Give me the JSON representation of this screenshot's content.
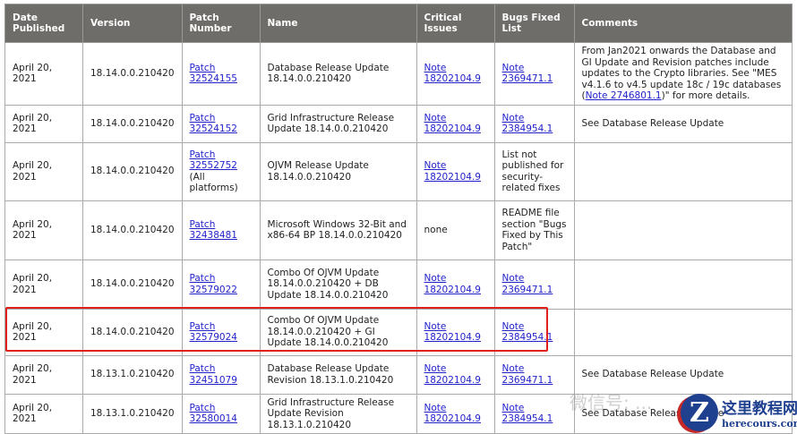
{
  "headers": [
    "Date Published",
    "Version",
    "Patch Number",
    "Name",
    "Critical Issues",
    "Bugs Fixed List",
    "Comments"
  ],
  "rows": [
    {
      "date": "April 20, 2021",
      "version": "18.14.0.0.210420",
      "patch": "Patch 32524155",
      "name": "Database Release Update 18.14.0.0.210420",
      "critical": "Note 18202104.9",
      "bugs": "Note 2369471.1",
      "comment_pre": "From Jan2021 onwards the Database and GI Update and Revision patches include updates to the Crypto libraries. See \"MES v4.1.6 to v4.5 update 18c / 19c databases (",
      "comment_link": "Note 2746801.1",
      "comment_post": ")\" for more details."
    },
    {
      "date": "April 20, 2021",
      "version": "18.14.0.0.210420",
      "patch": "Patch 32524152",
      "name": "Grid Infrastructure Release Update 18.14.0.0.210420",
      "critical": "Note 18202104.9",
      "bugs": "Note 2384954.1",
      "comment": "See Database Release Update"
    },
    {
      "date": "April 20, 2021",
      "version": "18.14.0.0.210420",
      "patch": "Patch 32552752",
      "patch_suffix": " (All platforms)",
      "name": "OJVM Release Update 18.14.0.0.210420",
      "critical": "Note 18202104.9",
      "bugs_text": "List not published for security-related fixes",
      "comment": ""
    },
    {
      "date": "April 20, 2021",
      "version": "18.14.0.0.210420",
      "patch": "Patch 32438481",
      "name": "Microsoft Windows 32-Bit and x86-64 BP 18.14.0.0.210420",
      "critical_text": "none",
      "bugs_text": "README file section \"Bugs Fixed by This Patch\"",
      "comment": ""
    },
    {
      "date": "April 20, 2021",
      "version": "18.14.0.0.210420",
      "patch": "Patch 32579022",
      "name": "Combo Of OJVM Update 18.14.0.0.210420 + DB Update 18.14.0.0.210420",
      "critical": "Note 18202104.9",
      "bugs": "Note 2369471.1",
      "comment": ""
    },
    {
      "date": "April 20, 2021",
      "version": "18.14.0.0.210420",
      "patch": "Patch 32579024",
      "name": "Combo Of OJVM Update 18.14.0.0.210420 + GI Update 18.14.0.0.210420",
      "critical": "Note 18202104.9",
      "bugs": "Note 2384954.1",
      "comment": ""
    },
    {
      "date": "April 20, 2021",
      "version": "18.13.1.0.210420",
      "patch": "Patch 32451079",
      "name": "Database Release Update Revision 18.13.1.0.210420",
      "critical": "Note 18202104.9",
      "bugs": "Note 2369471.1",
      "comment": "See Database Release Update"
    },
    {
      "date": "April 20, 2021",
      "version": "18.13.1.0.210420",
      "patch": "Patch 32580014",
      "name": "Grid Infrastructure Release Update Revision 18.13.1.0.210420",
      "critical": "Note 18202104.9",
      "bugs": "Note 2384954.1",
      "comment": "See Database Release Update"
    }
  ],
  "watermark": {
    "wechat": "微信号: ...",
    "site_cn": "这里教程网",
    "site_url": "herecours.com",
    "logo_letter": "Z"
  },
  "colors": {
    "header_bg": "#6e6d69",
    "link": "#2222cc",
    "highlight": "#e0201c"
  }
}
